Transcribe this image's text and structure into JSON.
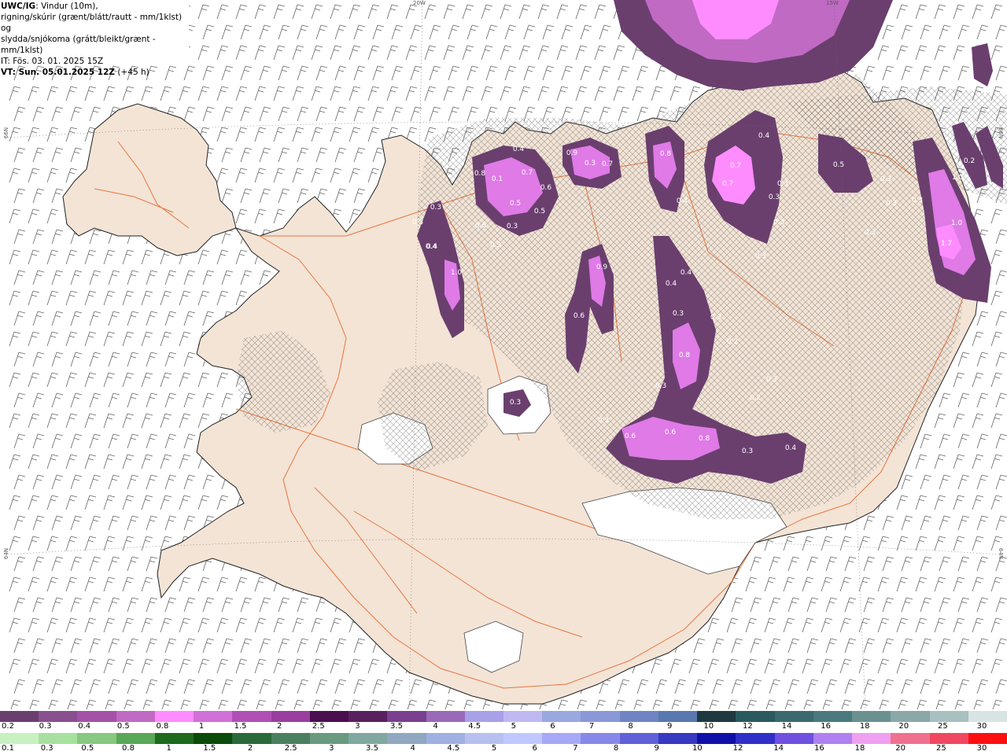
{
  "header": {
    "model": "UWC/IG",
    "line1_rest": ": Vindur (10m),",
    "line2": "rigning/skúrir (grænt/blátt/rautt - mm/1klst) og",
    "line3": "slydda/snjókoma (grátt/bleikt/grænt - mm/1klst)",
    "line4": "IT: Fös. 03. 01. 2025 15Z",
    "line5_bold": "VT: Sun. 05.01.2025 12Z",
    "line5_rest": " (+45 h)"
  },
  "grid_labels": {
    "lon_20w": "20W",
    "lon_15w": "15W",
    "lat_66n_left": "66N",
    "lat_66n_right": "66N",
    "lat_64n_left": "64N",
    "lat_64n_right": "64N"
  },
  "colors": {
    "land": "#f3e4d6",
    "sea": "#ffffff",
    "roads": "#e8682c",
    "snow_dark": "#6a3f6e",
    "snow_mid": "#a352a8",
    "snow_light": "#df7ae6",
    "snow_bright": "#ff8cff"
  },
  "precip_labels": [
    {
      "text": "0.4"
    },
    {
      "text": "0.8"
    },
    {
      "text": "0.1"
    },
    {
      "text": "0.7"
    },
    {
      "text": "0.6"
    },
    {
      "text": "0.5"
    },
    {
      "text": "0.5"
    },
    {
      "text": "0.3"
    },
    {
      "text": "0.9"
    },
    {
      "text": "0.3"
    },
    {
      "text": "0.7"
    },
    {
      "text": "0.8"
    },
    {
      "text": "0.4"
    },
    {
      "text": "0.7"
    },
    {
      "text": "0.7"
    },
    {
      "text": "0.3"
    },
    {
      "text": "0.3"
    },
    {
      "text": "0.4"
    },
    {
      "text": "0.3"
    },
    {
      "text": "0.5"
    },
    {
      "text": "0.3"
    },
    {
      "text": "0.3"
    },
    {
      "text": "0.3"
    },
    {
      "text": "0.3"
    },
    {
      "text": "1.0"
    },
    {
      "text": "1.0"
    },
    {
      "text": "1.7"
    },
    {
      "text": "0.4"
    },
    {
      "text": "0.3"
    },
    {
      "text": "0.3"
    },
    {
      "text": "0.4"
    },
    {
      "text": "0.3"
    },
    {
      "text": "1.0"
    },
    {
      "text": "0.6"
    },
    {
      "text": "0.3"
    },
    {
      "text": "0.9"
    },
    {
      "text": "0.6"
    },
    {
      "text": "0.4"
    },
    {
      "text": "0.4"
    },
    {
      "text": "0.2"
    },
    {
      "text": "0.3"
    },
    {
      "text": "0.3"
    },
    {
      "text": "0.2"
    },
    {
      "text": "0.8"
    },
    {
      "text": "0.3"
    },
    {
      "text": "0.3"
    },
    {
      "text": "0.2"
    },
    {
      "text": "0.3"
    },
    {
      "text": "0.3"
    },
    {
      "text": "0.6"
    },
    {
      "text": "0.6"
    },
    {
      "text": "0.8"
    },
    {
      "text": "0.3"
    },
    {
      "text": "0.4"
    }
  ],
  "legend_snow": {
    "colors": [
      "#6a3f6e",
      "#8a4f8e",
      "#a352a8",
      "#c06ac4",
      "#ff8cff",
      "#d070d8",
      "#b04fb6",
      "#9a3ea0",
      "#4a0f4e",
      "#5a1f5e",
      "#7a3f8e",
      "#9a6ab8",
      "#a8a0e8",
      "#c0b8f0",
      "#9aa8e0",
      "#8a98d8",
      "#6e84c4",
      "#5a78b0",
      "#1e3a40",
      "#2a5a5e",
      "#3a6a6e",
      "#4a7a7e",
      "#6a9090",
      "#8aa8a8",
      "#a8c0c0",
      "#d8e4e4"
    ],
    "labels": [
      "0.2",
      "0.3",
      "0.4",
      "0.5",
      "0.8",
      "1",
      "1.5",
      "2",
      "2.5",
      "3",
      "3.5",
      "4",
      "4.5",
      "5",
      "6",
      "7",
      "8",
      "9",
      "10",
      "12",
      "14",
      "16",
      "18",
      "20",
      "25",
      "30"
    ]
  },
  "legend_rain": {
    "colors": [
      "#c8f0c0",
      "#a8e0a0",
      "#88c880",
      "#58a858",
      "#1e6a1e",
      "#0a4a0a",
      "#2a6a3a",
      "#4a8060",
      "#6a9a80",
      "#80a8a0",
      "#90a8c0",
      "#a0b0e0",
      "#b8c0f0",
      "#c0c8ff",
      "#a8a8f8",
      "#8888e8",
      "#6060d8",
      "#3838c0",
      "#1010a8",
      "#3030c8",
      "#7050e0",
      "#b080f0",
      "#f0a0f0",
      "#f07090",
      "#f04860",
      "#ff1010"
    ],
    "labels": [
      "0.1",
      "0.3",
      "0.5",
      "0.8",
      "1",
      "1.5",
      "2",
      "2.5",
      "3",
      "3.5",
      "4",
      "4.5",
      "5",
      "6",
      "7",
      "8",
      "9",
      "10",
      "12",
      "14",
      "16",
      "18",
      "20",
      "25",
      "30"
    ]
  }
}
